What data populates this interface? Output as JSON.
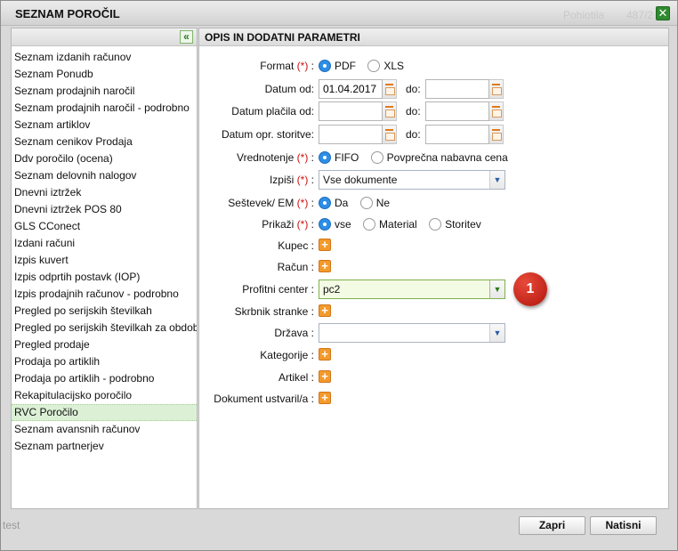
{
  "window": {
    "title": "SEZNAM POROČIL",
    "bg_counter": "487/2",
    "bg_link": "Pohiotila"
  },
  "left_panel": {
    "items": [
      "Seznam izdanih računov",
      "Seznam Ponudb",
      "Seznam prodajnih naročil",
      "Seznam prodajnih naročil - podrobno",
      "Seznam artiklov",
      "Seznam cenikov Prodaja",
      "Ddv poročilo (ocena)",
      "Seznam delovnih nalogov",
      "Dnevni iztržek",
      "Dnevni iztržek POS 80",
      "GLS CConect",
      "Izdani računi",
      "Izpis kuvert",
      "Izpis odprtih postavk (IOP)",
      "Izpis prodajnih računov - podrobno",
      "Pregled po serijskih številkah",
      "Pregled po serijskih številkah za obdobje",
      "Pregled prodaje",
      "Prodaja po artiklih",
      "Prodaja po artiklih - podrobno",
      "Rekapitulacijsko poročilo",
      "RVC Poročilo",
      "Seznam avansnih računov",
      "Seznam partnerjev"
    ],
    "selected_index": 21
  },
  "form": {
    "header": "OPIS IN DODATNI PARAMETRI",
    "required_mark": "(*)",
    "format": {
      "label": "Format",
      "options": [
        "PDF",
        "XLS"
      ],
      "selected": "PDF"
    },
    "datum_od": {
      "label": "Datum od:",
      "from_value": "01.04.2017",
      "to_label": "do:",
      "to_value": ""
    },
    "datum_placila": {
      "label": "Datum plačila od:",
      "to_label": "do:"
    },
    "datum_opr": {
      "label": "Datum opr. storitve:",
      "to_label": "do:"
    },
    "vrednotenje": {
      "label": "Vrednotenje",
      "options": [
        "FIFO",
        "Povprečna nabavna cena"
      ],
      "selected": "FIFO"
    },
    "izpisi": {
      "label": "Izpiši",
      "value": "Vse dokumente"
    },
    "sestevek": {
      "label": "Seštevek/ EM",
      "options": [
        "Da",
        "Ne"
      ],
      "selected": "Da"
    },
    "prikazi": {
      "label": "Prikaži",
      "options": [
        "vse",
        "Material",
        "Storitev"
      ],
      "selected": "vse"
    },
    "kupec": {
      "label": "Kupec :"
    },
    "racun": {
      "label": "Račun :"
    },
    "profitni_center": {
      "label": "Profitni center :",
      "value": "pc2"
    },
    "skrbnik": {
      "label": "Skrbnik stranke :"
    },
    "drzava": {
      "label": "Država :",
      "value": ""
    },
    "kategorije": {
      "label": "Kategorije :"
    },
    "artikel": {
      "label": "Artikel :"
    },
    "dokument_ustvaril": {
      "label": "Dokument ustvaril/a :"
    }
  },
  "callout_number": "1",
  "footer": {
    "close_label": "Zapri",
    "print_label": "Natisni",
    "bg_text": "test"
  },
  "colors": {
    "accent_blue": "#2d8ee6",
    "required_red": "#d01010",
    "plus_orange": "#f39a2c",
    "selected_green": "#dcf0d6",
    "callout_red": "#c41e12"
  }
}
